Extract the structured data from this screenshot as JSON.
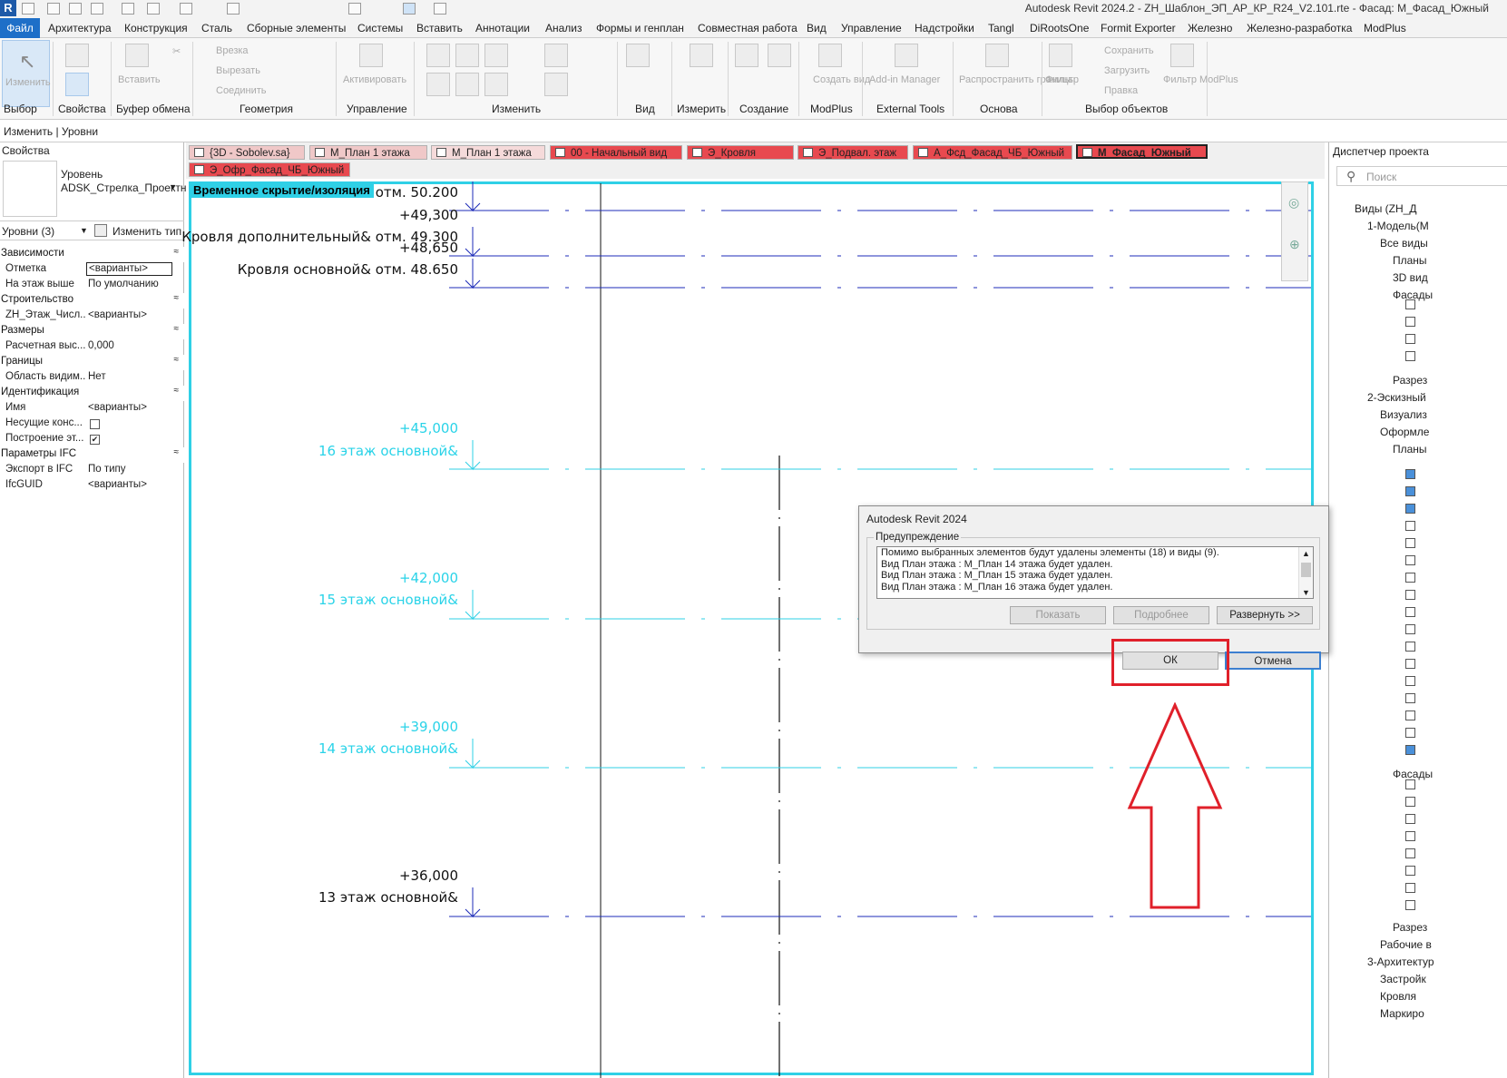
{
  "app": {
    "window_title": "Autodesk Revit 2024.2 - ZH_Шаблон_ЭП_АР_КР_R24_V2.101.rte - Фасад: М_Фасад_Южный",
    "logo": "R"
  },
  "menu": [
    "Файл",
    "Архитектура",
    "Конструкция",
    "Сталь",
    "Сборные элементы",
    "Системы",
    "Вставить",
    "Аннотации",
    "Анализ",
    "Формы и генплан",
    "Совместная работа",
    "Вид",
    "Управление",
    "Надстройки",
    "Tangl",
    "DiRootsOne",
    "Formit Exporter",
    "Железно",
    "Железно-разработка",
    "ModPlus"
  ],
  "ribbon": {
    "modify_label": "Изменить",
    "paste_label": "Вставить",
    "activate_label": "Активировать",
    "cut_insert": "Врезка",
    "cut": "Вырезать",
    "join": "Соединить",
    "create_view": "Создать вид",
    "addin_manager": "Add-in Manager",
    "distribute_bounds": "Распространить границы",
    "filter": "Фильтр",
    "save": "Сохранить",
    "load": "Загрузить",
    "edit": "Правка",
    "filter_modplus": "Фильтр ModPlus",
    "groups": [
      "Выбор",
      "Свойства",
      "Буфер обмена",
      "Геометрия",
      "Управление",
      "Изменить",
      "Вид",
      "Измерить",
      "Создание",
      "ModPlus",
      "External Tools",
      "Основа",
      "Выбор объектов"
    ]
  },
  "modify_bar": "Изменить | Уровни",
  "properties": {
    "title": "Свойства",
    "type_name": "Уровень ADSK_Стрелка_Проектная_Вверх",
    "type_selector": "Уровни (3)",
    "edit_type": "Изменить тип",
    "rows": [
      {
        "cat": "Зависимости"
      },
      {
        "label": "Отметка",
        "value": "<варианты>",
        "box": true
      },
      {
        "label": "На этаж выше",
        "value": "По умолчанию"
      },
      {
        "cat": "Строительство"
      },
      {
        "label": "ZH_Этаж_Числ...",
        "value": "<варианты>"
      },
      {
        "cat": "Размеры"
      },
      {
        "label": "Расчетная выс...",
        "value": "0,000"
      },
      {
        "cat": "Границы"
      },
      {
        "label": "Область видим...",
        "value": "Нет"
      },
      {
        "cat": "Идентификация"
      },
      {
        "label": "Имя",
        "value": "<варианты>"
      },
      {
        "label": "Несущие конс...",
        "value": "",
        "check": false
      },
      {
        "label": "Построение эт...",
        "value": "",
        "check": true
      },
      {
        "cat": "Параметры IFC"
      },
      {
        "label": "Экспорт в IFC",
        "value": "По типу"
      },
      {
        "label": "IfcGUID",
        "value": "<варианты>"
      }
    ]
  },
  "tabs": [
    {
      "label": "{3D - Sobolev.sa}",
      "style": "pink"
    },
    {
      "label": "М_План 1 этажа",
      "style": "pink"
    },
    {
      "label": "М_План 1 этажа",
      "style": "light"
    },
    {
      "label": "00 - Начальный вид",
      "style": "red"
    },
    {
      "label": "Э_Кровля",
      "style": "red"
    },
    {
      "label": "Э_Подвал. этаж",
      "style": "red"
    },
    {
      "label": "А_Фсд_Фасад_ЧБ_Южный",
      "style": "red"
    },
    {
      "label": "М_Фасад_Южный",
      "style": "active"
    },
    {
      "label": "Э_Офр_Фасад_ЧБ_Южный",
      "style": "red"
    }
  ],
  "canvas": {
    "banner": "Временное скрытие/изоляция",
    "levels": [
      {
        "elev": "отм. 50.200",
        "name": "",
        "color": "black"
      },
      {
        "elev": "+49,300",
        "name": "Кровля дополнительный& отм. 49.300",
        "color": "black"
      },
      {
        "elev": "+48,650",
        "name": "Кровля основной& отм. 48.650",
        "color": "black"
      },
      {
        "elev": "+45,000",
        "name": "16 этаж основной&",
        "color": "cyan"
      },
      {
        "elev": "+42,000",
        "name": "15 этаж основной&",
        "color": "cyan"
      },
      {
        "elev": "+39,000",
        "name": "14 этаж основной&",
        "color": "cyan"
      },
      {
        "elev": "+36,000",
        "name": "13 этаж основной&",
        "color": "black"
      }
    ]
  },
  "browser": {
    "title": "Диспетчер проекта",
    "search_placeholder": "Поиск",
    "nodes": [
      "Виды (ZH_Д",
      "1-Модель(М",
      "Все виды",
      "Планы",
      "3D вид",
      "Фасады",
      "Разрез",
      "2-Эскизный",
      "Визуализ",
      "Оформле",
      "Планы",
      "Фасады",
      "Разрез",
      "Рабочие в",
      "3-Архитектур",
      "Застройк",
      "Кровля",
      "Маркиро"
    ]
  },
  "dialog": {
    "title": "Autodesk Revit 2024",
    "group_label": "Предупреждение",
    "messages": [
      "Помимо выбранных элементов будут удалены элементы (18) и виды (9).",
      "Вид План этажа : М_План 14 этажа будет удален.",
      "Вид План этажа : М_План 15 этажа будет удален.",
      "Вид План этажа : М_План 16 этажа будет удален."
    ],
    "show": "Показать",
    "details": "Подробнее",
    "expand": "Развернуть >>",
    "ok": "ОК",
    "cancel": "Отмена"
  },
  "colors": {
    "accent": "#2fd0e6",
    "annotation": "#e0202a",
    "level_line": "#1c2bb8"
  }
}
